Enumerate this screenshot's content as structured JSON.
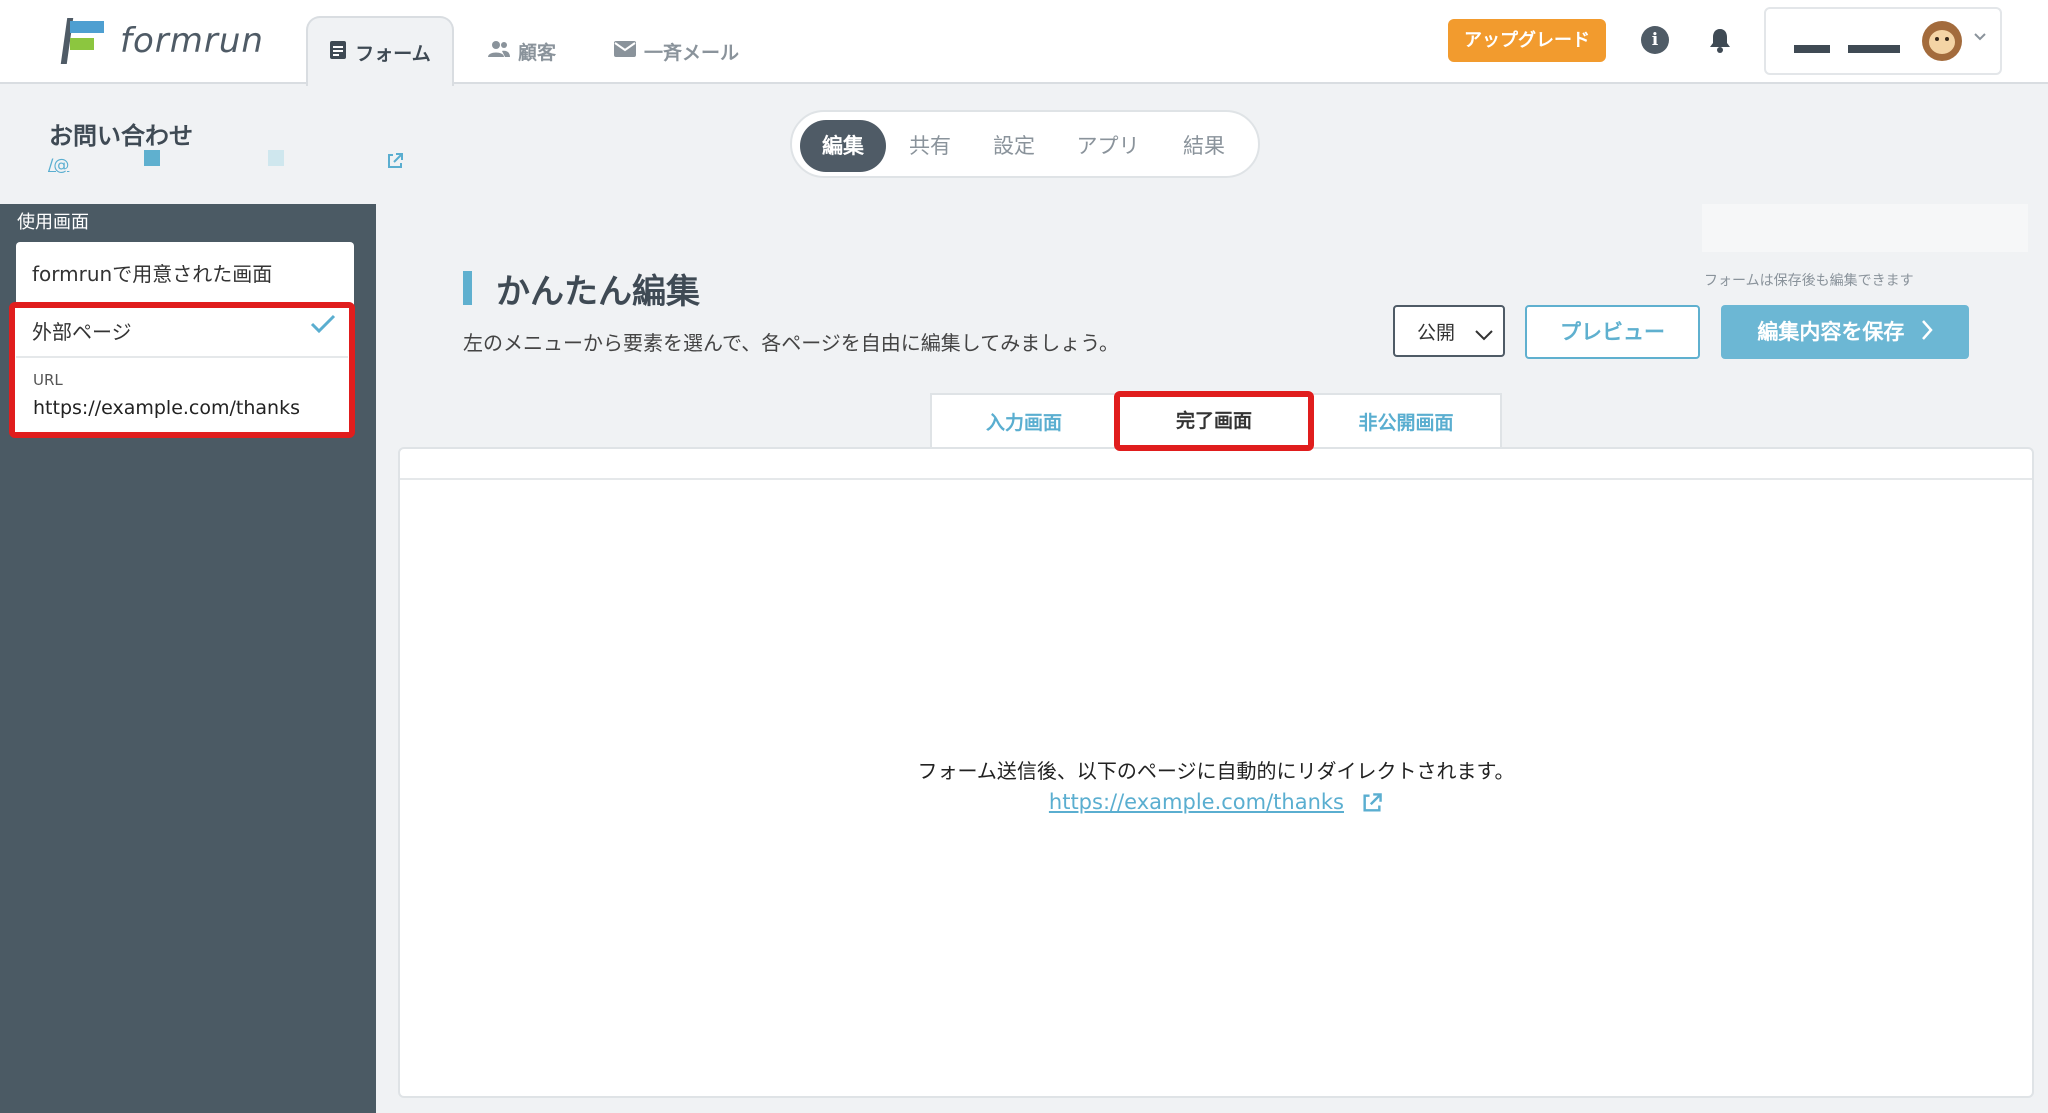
{
  "topnav": {
    "logo": "formrun",
    "tabs": [
      {
        "label": "フォーム",
        "icon": "document-icon"
      },
      {
        "label": "顧客",
        "icon": "users-icon"
      },
      {
        "label": "一斉メール",
        "icon": "mail-icon"
      }
    ],
    "upgrade_label": "アップグレード",
    "colors": {
      "upgrade": "#f29b2e",
      "accent": "#5fb0cf",
      "dark": "#4f5b66",
      "highlight": "#e01d1d"
    }
  },
  "form": {
    "title": "お問い合わせ",
    "email": "/@"
  },
  "segments": [
    "編集",
    "共有",
    "設定",
    "アプリ",
    "結果"
  ],
  "sidebar": {
    "section_label": "使用画面",
    "option_default": "formrunで用意された画面",
    "option_selected": "外部ページ",
    "url_label": "URL",
    "url_value": "https://example.com/thanks"
  },
  "main": {
    "title": "かんたん編集",
    "subtitle": "左のメニューから要素を選んで、各ページを自由に編集してみましょう。",
    "save_hint": "フォームは保存後も編集できます",
    "publish_value": "公開",
    "preview_label": "プレビュー",
    "save_label": "編集内容を保存"
  },
  "page_tabs": [
    "入力画面",
    "完了画面",
    "非公開画面"
  ],
  "panel": {
    "redirect_text": "フォーム送信後、以下のページに自動的にリダイレクトされます。",
    "redirect_url": "https://example.com/thanks"
  }
}
